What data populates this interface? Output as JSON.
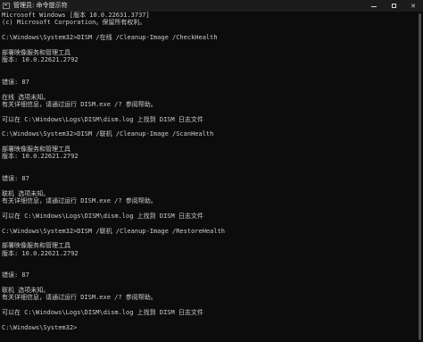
{
  "window": {
    "title": "管理员: 命令提示符"
  },
  "console": {
    "lines": [
      "Microsoft Windows [版本 10.0.22631.3737]",
      "(c) Microsoft Corporation。保留所有权利。",
      "",
      "C:\\Windows\\System32>DISM /在线 /Cleanup-Image /CheckHealth",
      "",
      "部署映像服务和管理工具",
      "版本: 10.0.22621.2792",
      "",
      "",
      "错误: 87",
      "",
      "在线 选项未知。",
      "有关详细信息，请通过运行 DISM.exe /? 参阅帮助。",
      "",
      "可以在 C:\\Windows\\Logs\\DISM\\dism.log 上找到 DISM 日志文件",
      "",
      "C:\\Windows\\System32>DISM /联机 /Cleanup-Image /ScanHealth",
      "",
      "部署映像服务和管理工具",
      "版本: 10.0.22621.2792",
      "",
      "",
      "错误: 87",
      "",
      "联机 选项未知。",
      "有关详细信息，请通过运行 DISM.exe /? 参阅帮助。",
      "",
      "可以在 C:\\Windows\\Logs\\DISM\\dism.log 上找到 DISM 日志文件",
      "",
      "C:\\Windows\\System32>DISM /联机 /Cleanup-Image /RestoreHealth",
      "",
      "部署映像服务和管理工具",
      "版本: 10.0.22621.2792",
      "",
      "",
      "错误: 87",
      "",
      "联机 选项未知。",
      "有关详细信息，请通过运行 DISM.exe /? 参阅帮助。",
      "",
      "可以在 C:\\Windows\\Logs\\DISM\\dism.log 上找到 DISM 日志文件",
      "",
      "C:\\Windows\\System32>"
    ]
  },
  "icons": {
    "app": "terminal-icon",
    "minimize": "minimize-icon",
    "maximize": "maximize-icon",
    "close": "close-icon"
  },
  "colors": {
    "background": "#0c0c0c",
    "text": "#cccccc",
    "titlebar": "#1c1c1c"
  }
}
